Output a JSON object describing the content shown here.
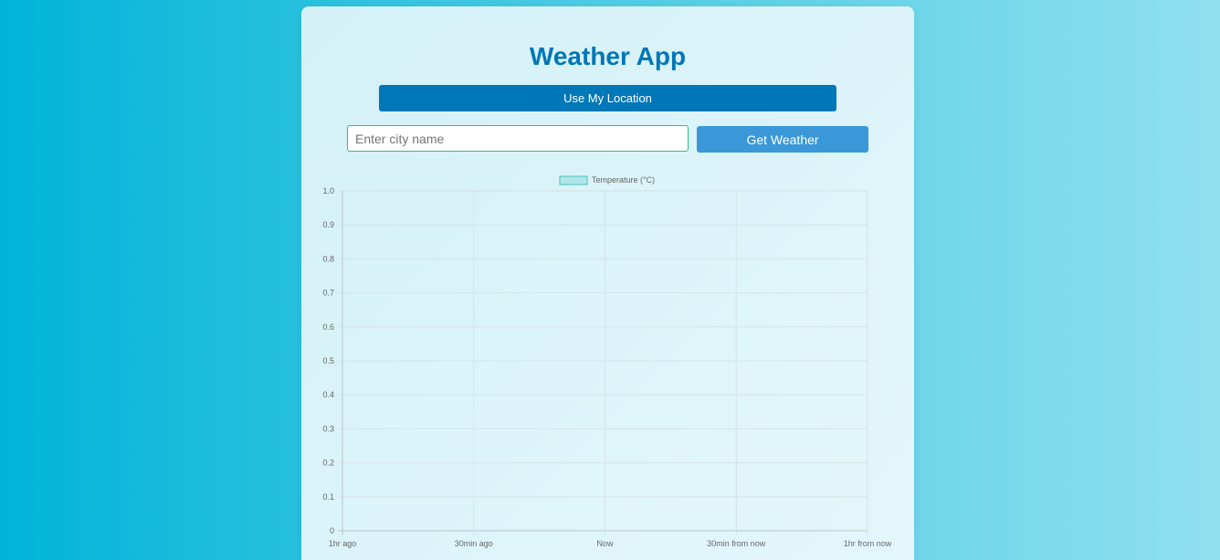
{
  "app": {
    "title": "Weather App"
  },
  "controls": {
    "location_button_label": "Use My Location",
    "city_input_placeholder": "Enter city name",
    "city_input_value": "",
    "get_weather_label": "Get Weather"
  },
  "colors": {
    "title": "#0077b6",
    "location_button": "#0077b6",
    "get_weather_button": "#3a98d8",
    "input_border": "#2dbf83",
    "series_fill": "#b2e6e8",
    "series_border": "#4bc0c0"
  },
  "chart_data": {
    "type": "line",
    "categories": [
      "1hr ago",
      "30min ago",
      "Now",
      "30min from now",
      "1hr from now"
    ],
    "series": [
      {
        "name": "Temperature (°C)",
        "values": []
      }
    ],
    "ylim": [
      0,
      1
    ],
    "yticks": [
      "0",
      "0.1",
      "0.2",
      "0.3",
      "0.4",
      "0.5",
      "0.6",
      "0.7",
      "0.8",
      "0.9",
      "1.0"
    ],
    "grid": true,
    "legend": "top"
  }
}
